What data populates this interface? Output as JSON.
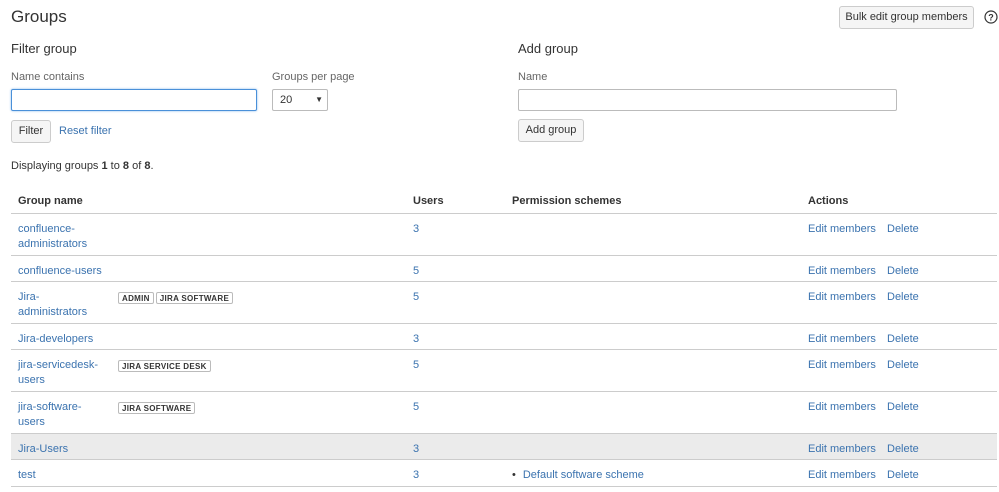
{
  "page_title": "Groups",
  "bulk_edit_label": "Bulk edit group members",
  "help_icon": "question-circle-icon",
  "filter": {
    "title": "Filter group",
    "name_label": "Name contains",
    "name_value": "",
    "per_page_label": "Groups per page",
    "per_page_value": "20",
    "filter_button": "Filter",
    "reset_link": "Reset filter"
  },
  "add": {
    "title": "Add group",
    "name_label": "Name",
    "name_value": "",
    "add_button": "Add group"
  },
  "display": {
    "prefix": "Displaying groups ",
    "from": "1",
    "to_word": " to ",
    "to": "8",
    "of_word": " of ",
    "total": "8",
    "suffix": "."
  },
  "table": {
    "headers": {
      "name": "Group name",
      "users": "Users",
      "permissions": "Permission schemes",
      "actions": "Actions"
    },
    "action_edit": "Edit members",
    "action_delete": "Delete",
    "rows": [
      {
        "name": "confluence-administrators",
        "badges": [],
        "users": "3",
        "permissions": []
      },
      {
        "name": "confluence-users",
        "badges": [],
        "users": "5",
        "permissions": []
      },
      {
        "name": "Jira-administrators",
        "badges": [
          "ADMIN",
          "JIRA SOFTWARE"
        ],
        "users": "5",
        "permissions": []
      },
      {
        "name": "Jira-developers",
        "badges": [],
        "users": "3",
        "permissions": []
      },
      {
        "name": "jira-servicedesk-users",
        "badges": [
          "JIRA SERVICE DESK"
        ],
        "users": "5",
        "permissions": []
      },
      {
        "name": "jira-software-users",
        "badges": [
          "JIRA SOFTWARE"
        ],
        "users": "5",
        "permissions": []
      },
      {
        "name": "Jira-Users",
        "badges": [],
        "users": "3",
        "permissions": [],
        "hovered": true
      },
      {
        "name": "test",
        "badges": [],
        "users": "3",
        "permissions": [
          "Default software scheme"
        ]
      }
    ]
  },
  "colors": {
    "link": "#3b73af",
    "row_hover": "#ebebeb",
    "border": "#cccccc"
  }
}
